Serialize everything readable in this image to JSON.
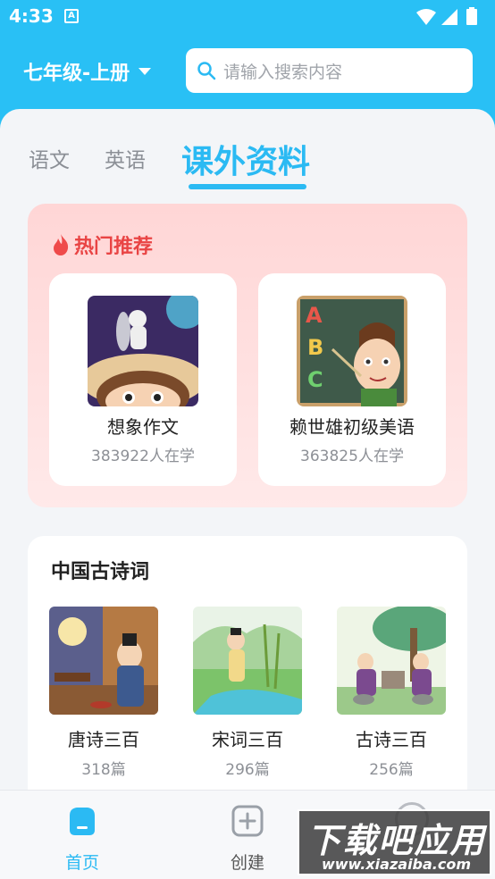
{
  "status_bar": {
    "time": "4:33",
    "notif_letter": "A"
  },
  "header": {
    "grade": "七年级-上册",
    "search_placeholder": "请输入搜索内容"
  },
  "tabs": [
    {
      "label": "语文",
      "active": false
    },
    {
      "label": "英语",
      "active": false
    },
    {
      "label": "课外资料",
      "active": true
    }
  ],
  "hot": {
    "title": "热门推荐",
    "items": [
      {
        "name": "想象作文",
        "meta": "383922人在学"
      },
      {
        "name": "赖世雄初级美语",
        "meta": "363825人在学"
      }
    ]
  },
  "poetry": {
    "title": "中国古诗词",
    "items": [
      {
        "name": "唐诗三百",
        "meta": "318篇"
      },
      {
        "name": "宋词三百",
        "meta": "296篇"
      },
      {
        "name": "古诗三百",
        "meta": "256篇"
      }
    ]
  },
  "bottom_nav": [
    {
      "label": "首页",
      "icon": "home-icon",
      "active": true
    },
    {
      "label": "创建",
      "icon": "plus-square-icon",
      "active": false
    }
  ],
  "watermark": {
    "big": "下载吧应用",
    "small": "www.xiazaiba.com"
  },
  "colors": {
    "accent": "#2bbaf3",
    "header_bg": "#29c0f5",
    "hot_red": "#e94444"
  }
}
